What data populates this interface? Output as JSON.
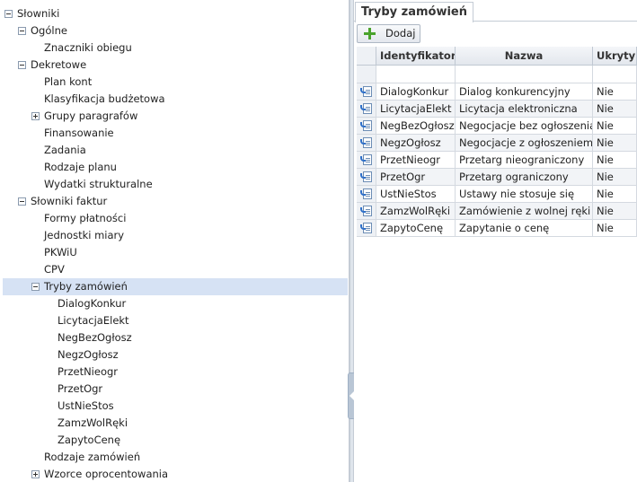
{
  "tree": {
    "nodes": [
      {
        "label": "Słowniki",
        "depth": 0,
        "expander": "minus"
      },
      {
        "label": "Ogólne",
        "depth": 1,
        "expander": "minus"
      },
      {
        "label": "Znaczniki obiegu",
        "depth": 2,
        "expander": "none"
      },
      {
        "label": "Dekretowe",
        "depth": 1,
        "expander": "minus"
      },
      {
        "label": "Plan kont",
        "depth": 2,
        "expander": "none"
      },
      {
        "label": "Klasyfikacja budżetowa",
        "depth": 2,
        "expander": "none"
      },
      {
        "label": "Grupy paragrafów",
        "depth": 2,
        "expander": "plus"
      },
      {
        "label": "Finansowanie",
        "depth": 2,
        "expander": "none"
      },
      {
        "label": "Zadania",
        "depth": 2,
        "expander": "none"
      },
      {
        "label": "Rodzaje planu",
        "depth": 2,
        "expander": "none"
      },
      {
        "label": "Wydatki strukturalne",
        "depth": 2,
        "expander": "none"
      },
      {
        "label": "Słowniki faktur",
        "depth": 1,
        "expander": "minus"
      },
      {
        "label": "Formy płatności",
        "depth": 2,
        "expander": "none"
      },
      {
        "label": "Jednostki miary",
        "depth": 2,
        "expander": "none"
      },
      {
        "label": "PKWiU",
        "depth": 2,
        "expander": "none"
      },
      {
        "label": "CPV",
        "depth": 2,
        "expander": "none"
      },
      {
        "label": "Tryby zamówień",
        "depth": 2,
        "expander": "minus",
        "selected": true
      },
      {
        "label": "DialogKonkur",
        "depth": 3,
        "expander": "none"
      },
      {
        "label": "LicytacjaElekt",
        "depth": 3,
        "expander": "none"
      },
      {
        "label": "NegBezOgłosz",
        "depth": 3,
        "expander": "none"
      },
      {
        "label": "NegzOgłosz",
        "depth": 3,
        "expander": "none"
      },
      {
        "label": "PrzetNieogr",
        "depth": 3,
        "expander": "none"
      },
      {
        "label": "PrzetOgr",
        "depth": 3,
        "expander": "none"
      },
      {
        "label": "UstNieStos",
        "depth": 3,
        "expander": "none"
      },
      {
        "label": "ZamzWolRęki",
        "depth": 3,
        "expander": "none"
      },
      {
        "label": "ZapytoCenę",
        "depth": 3,
        "expander": "none"
      },
      {
        "label": "Rodzaje zamówień",
        "depth": 2,
        "expander": "none"
      },
      {
        "label": "Wzorce oprocentowania",
        "depth": 2,
        "expander": "plus"
      }
    ]
  },
  "tab": {
    "title": "Tryby zamówień"
  },
  "toolbar": {
    "add_label": "Dodaj",
    "add_icon": "plus-icon",
    "add_icon_color": "#4aa32c"
  },
  "grid": {
    "columns": [
      "Identyfikator",
      "Nazwa",
      "Ukryty"
    ],
    "row_icon": "edit-record-icon",
    "rows": [
      {
        "id": "DialogKonkur",
        "name": "Dialog konkurencyjny",
        "hidden": "Nie"
      },
      {
        "id": "LicytacjaElekt",
        "name": "Licytacja elektroniczna",
        "hidden": "Nie"
      },
      {
        "id": "NegBezOgłosz",
        "name": "Negocjacje bez ogłoszenia",
        "hidden": "Nie"
      },
      {
        "id": "NegzOgłosz",
        "name": "Negocjacje z ogłoszeniem",
        "hidden": "Nie"
      },
      {
        "id": "PrzetNieogr",
        "name": "Przetarg nieograniczony",
        "hidden": "Nie"
      },
      {
        "id": "PrzetOgr",
        "name": "Przetarg ograniczony",
        "hidden": "Nie"
      },
      {
        "id": "UstNieStos",
        "name": "Ustawy nie stosuje się",
        "hidden": "Nie"
      },
      {
        "id": "ZamzWolRęki",
        "name": "Zamówienie z wolnej ręki",
        "hidden": "Nie"
      },
      {
        "id": "ZapytoCenę",
        "name": "Zapytanie o cenę",
        "hidden": "Nie"
      }
    ]
  },
  "colors": {
    "selection": "#d6e2f4",
    "border": "#c5ccd5",
    "alt_row": "#f2f4f7"
  }
}
